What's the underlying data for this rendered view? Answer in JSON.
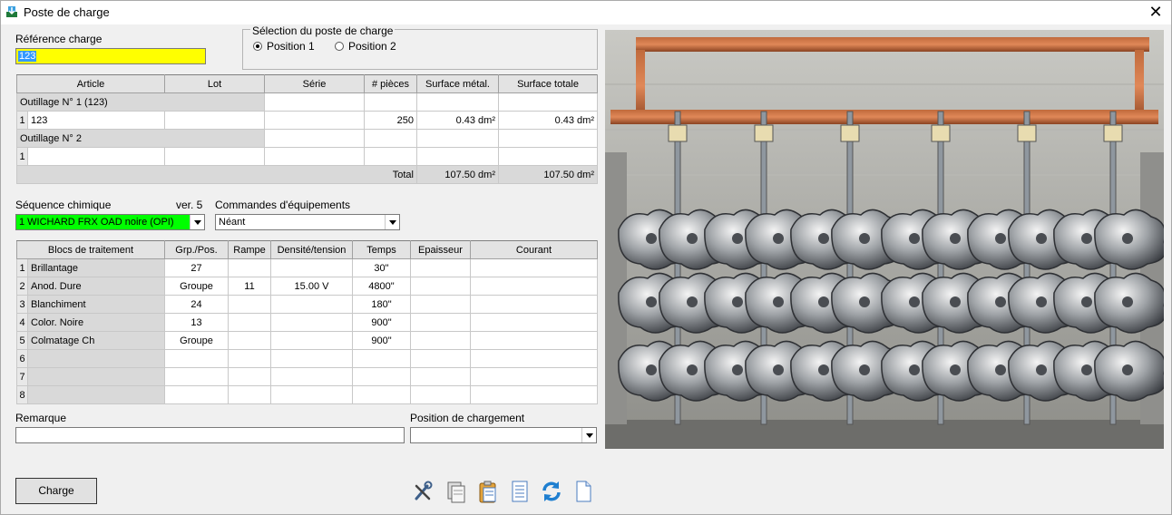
{
  "window": {
    "title": "Poste de charge"
  },
  "reference": {
    "label": "Référence charge",
    "value": "123"
  },
  "selection": {
    "legend": "Sélection du poste de charge",
    "options": [
      {
        "label": "Position 1",
        "checked": true
      },
      {
        "label": "Position 2",
        "checked": false
      }
    ]
  },
  "articles": {
    "headers": [
      "Article",
      "Lot",
      "Série",
      "# pièces",
      "Surface métal.",
      "Surface totale"
    ],
    "outillage1": "Outillage N° 1  (123)",
    "row1": {
      "index": "1",
      "article": "123",
      "pieces": "250",
      "surface_metal": "0.43 dm²",
      "surface_totale": "0.43 dm²"
    },
    "outillage2": "Outillage N° 2",
    "row2": {
      "index": "1"
    },
    "total_label": "Total",
    "total_metal": "107.50 dm²",
    "total_totale": "107.50 dm²"
  },
  "sequence": {
    "label": "Séquence chimique",
    "version": "ver. 5",
    "value": "1 WICHARD FRX OAD noire (OPI)",
    "color": "#00ff00"
  },
  "equipements": {
    "label": "Commandes d'équipements",
    "value": "Néant"
  },
  "blocs": {
    "headers": [
      "Blocs de traitement",
      "Grp./Pos.",
      "Rampe",
      "Densité/tension",
      "Temps",
      "Epaisseur",
      "Courant"
    ],
    "rows": [
      {
        "index": "1",
        "name": "Brillantage",
        "grp": "27",
        "rampe": "",
        "densite": "",
        "temps": "30\""
      },
      {
        "index": "2",
        "name": "Anod. Dure",
        "grp": "Groupe",
        "rampe": "11",
        "densite": "15.00 V",
        "temps": "4800\""
      },
      {
        "index": "3",
        "name": "Blanchiment",
        "grp": "24",
        "rampe": "",
        "densite": "",
        "temps": "180\""
      },
      {
        "index": "4",
        "name": "Color. Noire",
        "grp": "13",
        "rampe": "",
        "densite": "",
        "temps": "900\""
      },
      {
        "index": "5",
        "name": "Colmatage Ch",
        "grp": "Groupe",
        "rampe": "",
        "densite": "",
        "temps": "900\""
      },
      {
        "index": "6",
        "name": "",
        "grp": "",
        "rampe": "",
        "densite": "",
        "temps": ""
      },
      {
        "index": "7",
        "name": "",
        "grp": "",
        "rampe": "",
        "densite": "",
        "temps": ""
      },
      {
        "index": "8",
        "name": "",
        "grp": "",
        "rampe": "",
        "densite": "",
        "temps": ""
      }
    ]
  },
  "remarque": {
    "label": "Remarque",
    "value": ""
  },
  "position_chargement": {
    "label": "Position de chargement",
    "value": ""
  },
  "actions": {
    "charge_label": "Charge"
  },
  "toolbar_icons": [
    "tools-icon",
    "document-stack-icon",
    "clipboard-icon",
    "document-list-icon",
    "refresh-icon",
    "blank-document-icon"
  ]
}
